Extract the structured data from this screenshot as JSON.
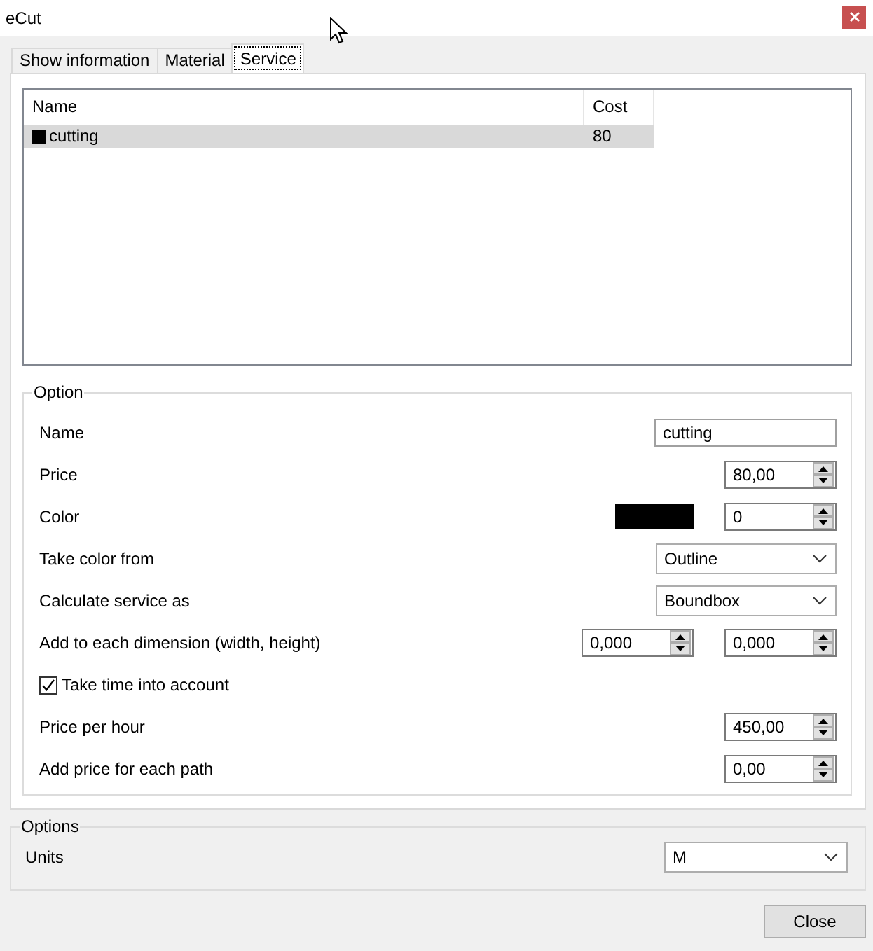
{
  "window": {
    "title": "eCut"
  },
  "tabs": [
    {
      "label": "Show information",
      "selected": false
    },
    {
      "label": "Material",
      "selected": false
    },
    {
      "label": "Service",
      "selected": true
    }
  ],
  "service_list": {
    "columns": [
      "Name",
      "Cost"
    ],
    "rows": [
      {
        "name": "cutting",
        "cost": "80",
        "color": "#000000",
        "selected": true
      }
    ]
  },
  "option": {
    "title": "Option",
    "rows": [
      {
        "kind": "text",
        "label": "Name",
        "value": "cutting"
      },
      {
        "kind": "spin",
        "label": "Price",
        "value": "80,00"
      },
      {
        "kind": "color",
        "label": "Color",
        "color": "#000000",
        "value": "0"
      },
      {
        "kind": "select",
        "label": "Take color from",
        "value": "Outline"
      },
      {
        "kind": "select",
        "label": "Calculate service as",
        "value": "Boundbox"
      },
      {
        "kind": "spin2",
        "label": "Add to each dimension (width, height)",
        "values": [
          "0,000",
          "0,000"
        ]
      },
      {
        "kind": "checkbox",
        "label": "Take time into account",
        "checked": true
      },
      {
        "kind": "spin",
        "label": "Price per hour",
        "value": "450,00"
      },
      {
        "kind": "spin",
        "label": "Add price for each path",
        "value": "0,00"
      }
    ]
  },
  "options": {
    "title": "Options",
    "rows": [
      {
        "kind": "select",
        "label": "Units",
        "value": "M"
      }
    ]
  },
  "buttons": [
    "Close"
  ]
}
